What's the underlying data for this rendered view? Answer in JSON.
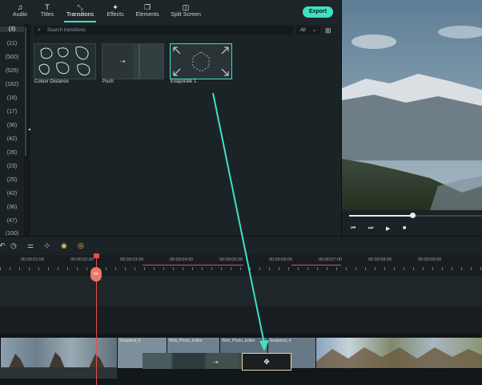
{
  "toolbar": {
    "tabs": [
      {
        "label": "Audio",
        "icon": "music-note-icon"
      },
      {
        "label": "Titles",
        "icon": "text-t-icon"
      },
      {
        "label": "Transitions",
        "icon": "transitions-icon",
        "active": true
      },
      {
        "label": "Effects",
        "icon": "sparkle-effects-icon"
      },
      {
        "label": "Elements",
        "icon": "elements-icon"
      },
      {
        "label": "Split Screen",
        "icon": "split-screen-icon"
      }
    ],
    "export_label": "Export",
    "accent_color": "#3fe0c4"
  },
  "categories": [
    "(3)",
    "(21)",
    "(500)",
    "(526)",
    "(182)",
    "(16)",
    "(17)",
    "(36)",
    "(42)",
    "(26)",
    "(23)",
    "(25)",
    "(42)",
    "(36)",
    "(47)",
    "(100)"
  ],
  "search": {
    "placeholder": "Search transitions",
    "filter_value": "All"
  },
  "transitions": [
    {
      "label": "Colour Distance"
    },
    {
      "label": "Push"
    },
    {
      "label": "Evaporate 1",
      "selected": true
    }
  ],
  "preview": {
    "progress": 0.48
  },
  "timeline": {
    "timecodes": [
      "00:00:01:00",
      "00:00:02:00",
      "00:00:03:00",
      "00:00:04:00",
      "00:00:05:00",
      "00:00:06:00",
      "00:00:07:00",
      "00:00:08:00",
      "00:00:09:00"
    ],
    "clips": [
      "Snapshot_6",
      "Web_Photo_Editor",
      "Web_Photo_Editor",
      "Snapshot_4"
    ],
    "marker_color": "#e35050"
  }
}
